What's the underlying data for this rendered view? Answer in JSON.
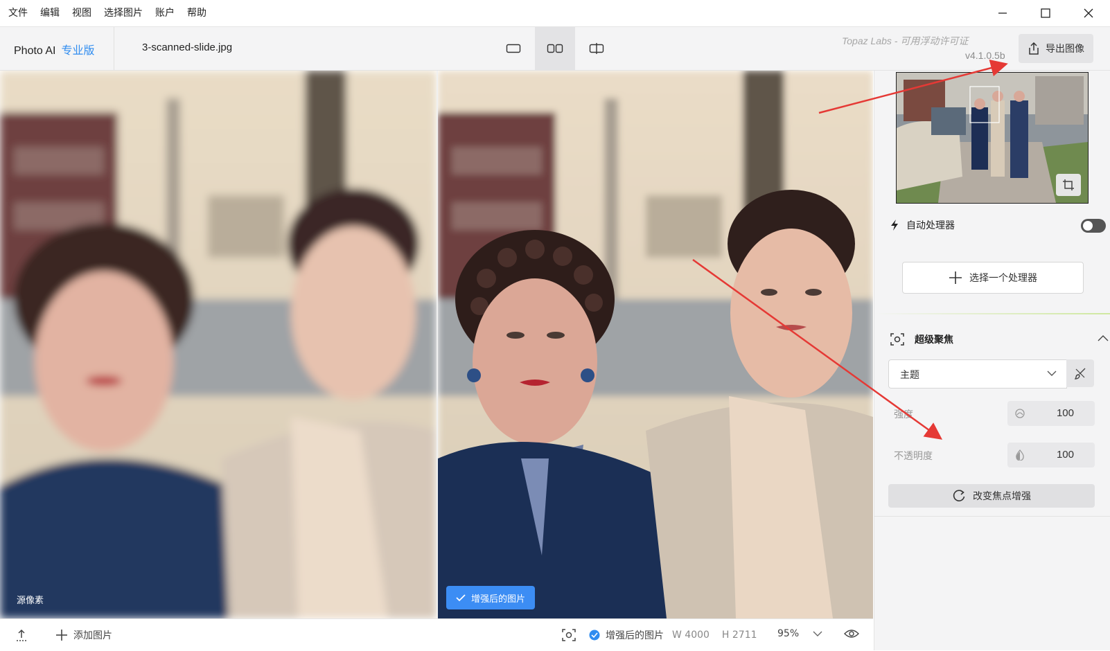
{
  "menu": [
    "文件",
    "编辑",
    "视图",
    "选择图片",
    "账户",
    "帮助"
  ],
  "toolbar": {
    "app_name": "Photo AI",
    "edition": "专业版",
    "filename": "3-scanned-slide.jpg",
    "license": "Topaz Labs - 可用浮动许可证",
    "version": "v4.1.0.5b",
    "export_label": "导出图像"
  },
  "panes": {
    "original_label": "源像素",
    "enhanced_label": "增强后的图片"
  },
  "bottom": {
    "add_image": "添加图片",
    "enhanced_label": "增强后的图片",
    "width": "W 4000",
    "height": "H 2711",
    "zoom": "95%"
  },
  "panel": {
    "auto_processor": "自动处理器",
    "auto_enabled": false,
    "select_processor": "选择一个处理器",
    "section_title": "超级聚焦",
    "mode": "主题",
    "strength_label": "强度",
    "strength_value": "100",
    "opacity_label": "不透明度",
    "opacity_value": "100",
    "change_button": "改变焦点增强"
  },
  "colors": {
    "accent": "#2f8cf0",
    "annotation_arrow": "#e53935"
  }
}
